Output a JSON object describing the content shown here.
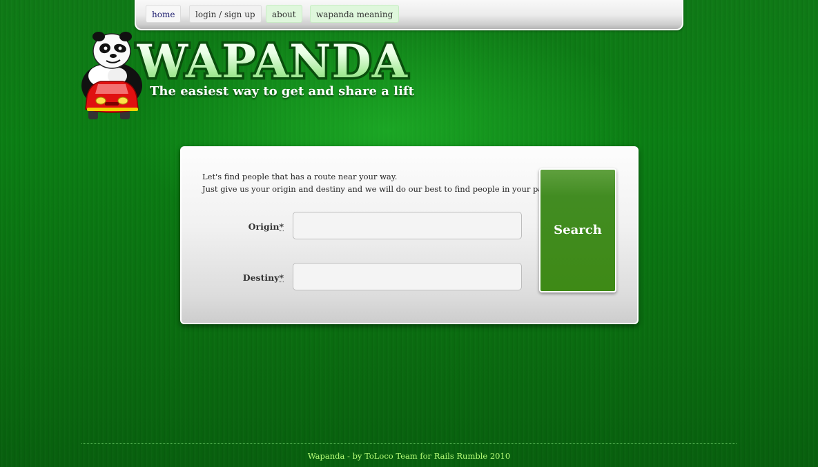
{
  "nav": {
    "items": [
      {
        "label": "home"
      },
      {
        "label": "login / sign up"
      },
      {
        "label": "about"
      },
      {
        "label": "wapanda meaning"
      }
    ]
  },
  "logo": {
    "title": "WAPANDA",
    "tagline": "The easiest way to get and share a lift",
    "mascot_icon": "panda-driving-red-car-icon"
  },
  "search": {
    "intro_line1": "Let's find people that has a route near your way.",
    "intro_line2": "Just give us your origin and destiny and we will do our best to find people in your path.",
    "origin_label": "Origin",
    "destiny_label": "Destiny",
    "required_marker": "*",
    "origin_value": "",
    "destiny_value": "",
    "button_label": "Search"
  },
  "footer": {
    "text": "Wapanda - by ToLoco Team for Rails Rumble 2010"
  },
  "colors": {
    "background": "#0b7f14",
    "search_button": "#428c22",
    "footer_text": "#b8ff7a"
  }
}
